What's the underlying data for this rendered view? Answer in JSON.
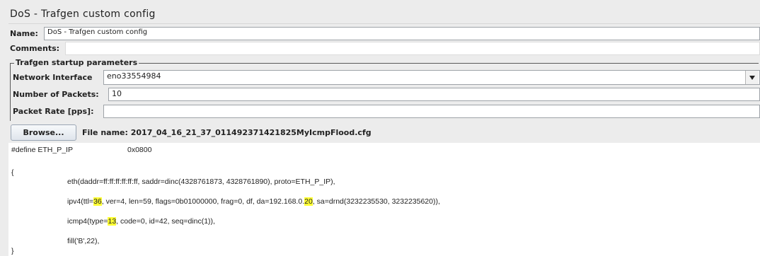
{
  "title": "DoS - Trafgen custom config",
  "name": {
    "label": "Name:",
    "value": "DoS - Trafgen custom config"
  },
  "comments": {
    "label": "Comments:",
    "value": ""
  },
  "startup_group": {
    "title": "Trafgen startup parameters",
    "network_interface": {
      "label": "Network Interface",
      "value": "eno33554984"
    },
    "num_packets": {
      "label": "Number of Packets:",
      "value": "10"
    },
    "packet_rate": {
      "label": "Packet Rate [pps]:",
      "value": ""
    }
  },
  "browse": {
    "button_label": "Browse...",
    "file_label": "File name: 2017_04_16_21_37_011492371421825MyIcmpFlood.cfg"
  },
  "config_text": {
    "define_name": "#define ETH_P_IP",
    "define_value": "0x0800",
    "open_brace": "{",
    "eth": "eth(daddr=ff:ff:ff:ff:ff:ff, saddr=dinc(4328761873, 4328761890), proto=ETH_P_IP),",
    "ipv4_pre": "ipv4(ttl=",
    "ipv4_ttl": "36",
    "ipv4_mid": ", ver=4, len=59, flags=0b01000000, frag=0, df, da=192.168.0.",
    "ipv4_da": "20",
    "ipv4_post": ", sa=drnd(3232235530, 3232235620)),",
    "icmp_pre": "icmp4(type=",
    "icmp_type": "13",
    "icmp_post": ", code=0, id=42, seq=dinc(1)),",
    "fill": "fill('B',22),",
    "close_brace": "}"
  },
  "colors": {
    "highlight": "#ffff33",
    "background": "#ececec"
  },
  "icons": {
    "combo_arrow": "chevron-down-icon"
  }
}
